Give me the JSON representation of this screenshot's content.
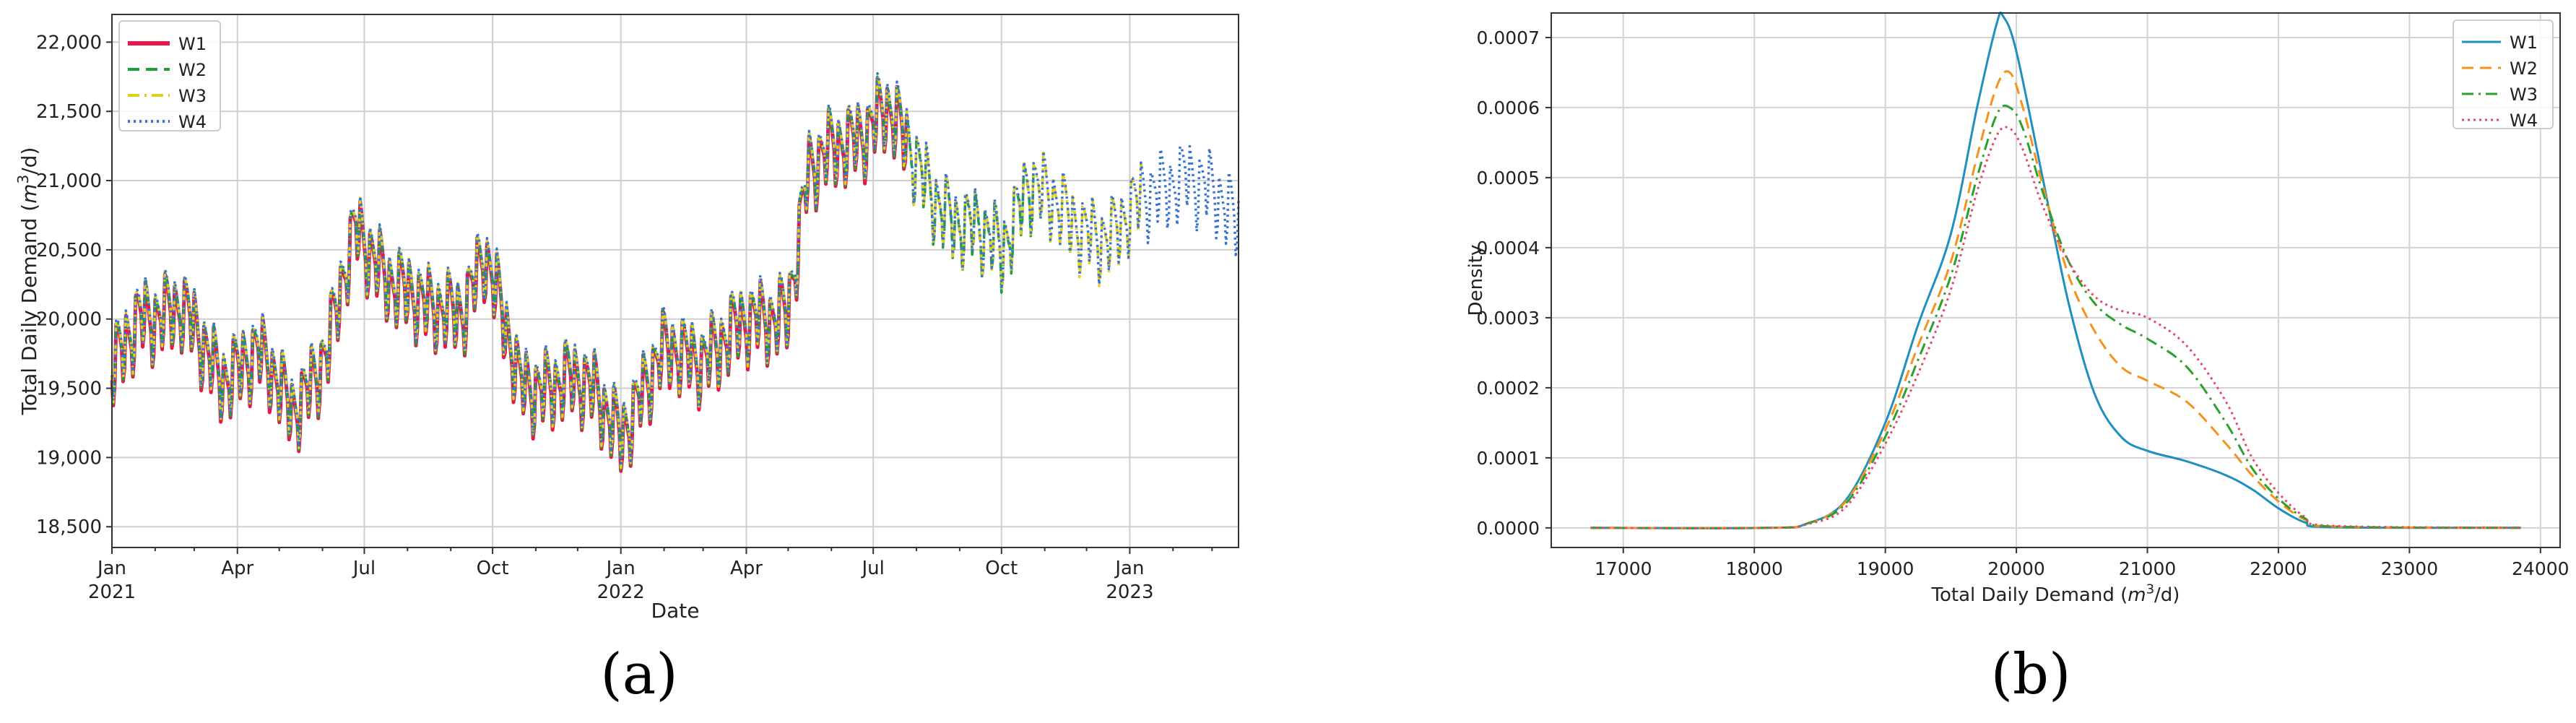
{
  "chart_data": [
    {
      "type": "line",
      "panel_label": "(a)",
      "xlabel": "Date",
      "ylabel": "Total Daily Demand (m³/d)",
      "ylabel_parts": {
        "pre": "Total Daily Demand (",
        "unit": "m",
        "sup": "3",
        "post": "/d)"
      },
      "xlim": [
        "2021-01-01",
        "2023-03-20"
      ],
      "ylim": [
        18350,
        22200
      ],
      "grid": true,
      "legend": "top-left",
      "y_ticks": [
        {
          "value": 18500,
          "label": "18,500"
        },
        {
          "value": 19000,
          "label": "19,000"
        },
        {
          "value": 19500,
          "label": "19,500"
        },
        {
          "value": 20000,
          "label": "20,000"
        },
        {
          "value": 20500,
          "label": "20,500"
        },
        {
          "value": 21000,
          "label": "21,000"
        },
        {
          "value": 21500,
          "label": "21,500"
        },
        {
          "value": 22000,
          "label": "22,000"
        }
      ],
      "x_ticks": [
        {
          "date": "2021-01-01",
          "label": "Jan",
          "year": "2021"
        },
        {
          "date": "2021-04-01",
          "label": "Apr"
        },
        {
          "date": "2021-07-01",
          "label": "Jul"
        },
        {
          "date": "2021-10-01",
          "label": "Oct"
        },
        {
          "date": "2022-01-01",
          "label": "Jan",
          "year": "2022"
        },
        {
          "date": "2022-04-01",
          "label": "Apr"
        },
        {
          "date": "2022-07-01",
          "label": "Jul"
        },
        {
          "date": "2022-10-01",
          "label": "Oct"
        },
        {
          "date": "2023-01-01",
          "label": "Jan",
          "year": "2023"
        }
      ],
      "weekly_amplitude": 260,
      "trend": [
        [
          "2021-01-01",
          19550
        ],
        [
          "2021-01-20",
          20050
        ],
        [
          "2021-02-20",
          20000
        ],
        [
          "2021-03-20",
          19600
        ],
        [
          "2021-04-15",
          19700
        ],
        [
          "2021-05-10",
          19350
        ],
        [
          "2021-06-05",
          19750
        ],
        [
          "2021-06-25",
          20600
        ],
        [
          "2021-07-20",
          20300
        ],
        [
          "2021-08-15",
          20000
        ],
        [
          "2021-09-10",
          20100
        ],
        [
          "2021-09-25",
          20450
        ],
        [
          "2021-10-20",
          19500
        ],
        [
          "2021-11-20",
          19550
        ],
        [
          "2021-12-15",
          19400
        ],
        [
          "2022-01-01",
          19200
        ],
        [
          "2022-02-01",
          19700
        ],
        [
          "2022-03-01",
          19750
        ],
        [
          "2022-04-01",
          19900
        ],
        [
          "2022-05-01",
          20100
        ],
        [
          "2022-05-15",
          21000
        ],
        [
          "2022-06-15",
          21300
        ],
        [
          "2022-07-10",
          21500
        ],
        [
          "2022-08-01",
          21050
        ],
        [
          "2022-09-01",
          20650
        ],
        [
          "2022-10-01",
          20450
        ],
        [
          "2022-10-20",
          21000
        ],
        [
          "2022-11-20",
          20600
        ],
        [
          "2022-12-20",
          20600
        ],
        [
          "2023-01-15",
          20800
        ],
        [
          "2023-02-10",
          21050
        ],
        [
          "2023-03-20",
          20600
        ]
      ],
      "series": [
        {
          "name": "W1",
          "color": "#e8174a",
          "style": "solid",
          "end": "2022-07-25"
        },
        {
          "name": "W2",
          "color": "#1f9e3c",
          "style": "dashed",
          "end": "2022-10-25"
        },
        {
          "name": "W3",
          "color": "#e2cf1a",
          "style": "dashdot",
          "end": "2023-01-10"
        },
        {
          "name": "W4",
          "color": "#3a73d6",
          "style": "dotted",
          "end": "2023-03-20"
        }
      ]
    },
    {
      "type": "line",
      "panel_label": "(b)",
      "xlabel": "Total Daily Demand (m³/d)",
      "xlabel_parts": {
        "pre": "Total Daily Demand (",
        "unit": "m",
        "sup": "3",
        "post": "/d)"
      },
      "ylabel": "Density",
      "xlim": [
        16450,
        24150
      ],
      "ylim": [
        -2.8e-05,
        0.000735
      ],
      "grid": true,
      "legend": "top-right",
      "x_ticks": [
        17000,
        18000,
        19000,
        20000,
        21000,
        22000,
        23000,
        24000
      ],
      "y_ticks": [
        {
          "value": 0.0,
          "label": "0.0000"
        },
        {
          "value": 0.0001,
          "label": "0.0001"
        },
        {
          "value": 0.0002,
          "label": "0.0002"
        },
        {
          "value": 0.0003,
          "label": "0.0003"
        },
        {
          "value": 0.0004,
          "label": "0.0004"
        },
        {
          "value": 0.0005,
          "label": "0.0005"
        },
        {
          "value": 0.0006,
          "label": "0.0006"
        },
        {
          "value": 0.0007,
          "label": "0.0007"
        }
      ],
      "x_range": [
        16750,
        23850
      ],
      "series": [
        {
          "name": "W1",
          "color": "#1f8fc0",
          "style": "solid",
          "points": [
            [
              16750,
              0
            ],
            [
              18100,
              0
            ],
            [
              18400,
              6e-06
            ],
            [
              18700,
              4e-05
            ],
            [
              19000,
              0.00015
            ],
            [
              19250,
              0.00029
            ],
            [
              19500,
              0.00042
            ],
            [
              19700,
              0.0006
            ],
            [
              19850,
              0.00072
            ],
            [
              19900,
              0.00073
            ],
            [
              20000,
              0.00068
            ],
            [
              20200,
              0.0005
            ],
            [
              20400,
              0.00032
            ],
            [
              20600,
              0.00019
            ],
            [
              20800,
              0.00013
            ],
            [
              21000,
              0.00011
            ],
            [
              21300,
              9.5e-05
            ],
            [
              21600,
              7.5e-05
            ],
            [
              21800,
              5.5e-05
            ],
            [
              22000,
              2.8e-05
            ],
            [
              22200,
              8e-06
            ],
            [
              22400,
              1e-06
            ],
            [
              23850,
              0
            ]
          ]
        },
        {
          "name": "W2",
          "color": "#f5921e",
          "style": "dashed",
          "points": [
            [
              16750,
              0
            ],
            [
              18100,
              0
            ],
            [
              18400,
              6e-06
            ],
            [
              18700,
              3.8e-05
            ],
            [
              19000,
              0.00014
            ],
            [
              19250,
              0.00026
            ],
            [
              19500,
              0.00038
            ],
            [
              19700,
              0.00053
            ],
            [
              19850,
              0.00063
            ],
            [
              19950,
              0.00065
            ],
            [
              20050,
              0.0006
            ],
            [
              20200,
              0.00049
            ],
            [
              20400,
              0.00036
            ],
            [
              20600,
              0.00028
            ],
            [
              20800,
              0.00023
            ],
            [
              21000,
              0.00021
            ],
            [
              21300,
              0.00018
            ],
            [
              21600,
              0.00012
            ],
            [
              21800,
              7.5e-05
            ],
            [
              22000,
              3.8e-05
            ],
            [
              22200,
              1.2e-05
            ],
            [
              22400,
              2e-06
            ],
            [
              23850,
              0
            ]
          ]
        },
        {
          "name": "W3",
          "color": "#2ca02c",
          "style": "dashdot",
          "points": [
            [
              16750,
              0
            ],
            [
              18100,
              0
            ],
            [
              18400,
              6e-06
            ],
            [
              18700,
              3.5e-05
            ],
            [
              19000,
              0.00013
            ],
            [
              19250,
              0.00024
            ],
            [
              19500,
              0.00036
            ],
            [
              19700,
              0.0005
            ],
            [
              19850,
              0.00059
            ],
            [
              19950,
              0.0006
            ],
            [
              20050,
              0.00057
            ],
            [
              20200,
              0.00048
            ],
            [
              20400,
              0.00038
            ],
            [
              20600,
              0.00032
            ],
            [
              20800,
              0.00029
            ],
            [
              21000,
              0.00027
            ],
            [
              21300,
              0.00023
            ],
            [
              21600,
              0.00015
            ],
            [
              21800,
              8.5e-05
            ],
            [
              22000,
              4.2e-05
            ],
            [
              22200,
              1.4e-05
            ],
            [
              22400,
              2e-06
            ],
            [
              23850,
              0
            ]
          ]
        },
        {
          "name": "W4",
          "color": "#e8486a",
          "style": "dotted",
          "points": [
            [
              16750,
              0
            ],
            [
              18100,
              0
            ],
            [
              18400,
              5e-06
            ],
            [
              18700,
              3e-05
            ],
            [
              19000,
              0.00012
            ],
            [
              19250,
              0.00022
            ],
            [
              19500,
              0.00034
            ],
            [
              19700,
              0.00048
            ],
            [
              19850,
              0.00056
            ],
            [
              19950,
              0.00057
            ],
            [
              20050,
              0.00054
            ],
            [
              20200,
              0.00046
            ],
            [
              20400,
              0.00038
            ],
            [
              20600,
              0.00033
            ],
            [
              20800,
              0.00031
            ],
            [
              21000,
              0.0003
            ],
            [
              21300,
              0.00026
            ],
            [
              21600,
              0.00018
            ],
            [
              21800,
              0.0001
            ],
            [
              22000,
              5e-05
            ],
            [
              22200,
              1.6e-05
            ],
            [
              22400,
              3e-06
            ],
            [
              23850,
              0
            ]
          ]
        }
      ]
    }
  ]
}
